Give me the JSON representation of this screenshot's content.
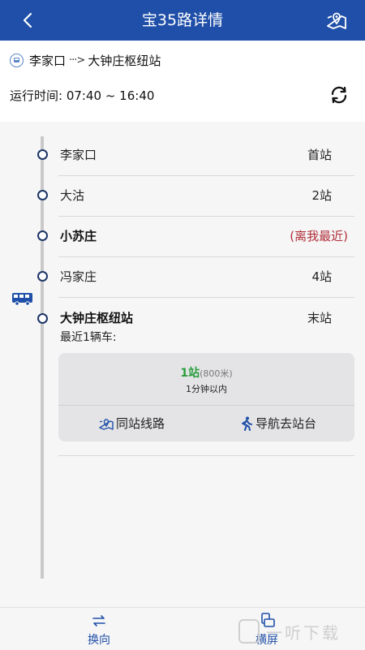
{
  "header": {
    "title": "宝35路详情",
    "back_icon": "chevron-left-icon",
    "map_icon": "map-pin-icon"
  },
  "route": {
    "from": "李家口",
    "arrow": "···>",
    "to": "大钟庄枢纽站",
    "time_label": "运行时间:",
    "time_range": "07:40 ~ 16:40"
  },
  "stops": [
    {
      "name": "李家口",
      "status": "首站"
    },
    {
      "name": "大沽",
      "status": "2站"
    },
    {
      "name": "小苏庄",
      "status": "(离我最近)"
    },
    {
      "name": "冯家庄",
      "status": "4站"
    }
  ],
  "terminal": {
    "name": "大钟庄枢纽站",
    "status": "末站",
    "nearest_label": "最近1辆车:"
  },
  "arrival_card": {
    "stops_away": "1站",
    "distance": "(800米)",
    "eta": "1分钟以内",
    "action_same_station": "同站线路",
    "action_navigate": "导航去站台"
  },
  "bottom_bar": {
    "swap_label": "换向",
    "landscape_label": "横屏"
  },
  "watermark": "一听下载",
  "colors": {
    "header_bg": "#1f4fa8",
    "near_stop": "#b0303a",
    "stops_count_green": "#2a9d3d"
  }
}
